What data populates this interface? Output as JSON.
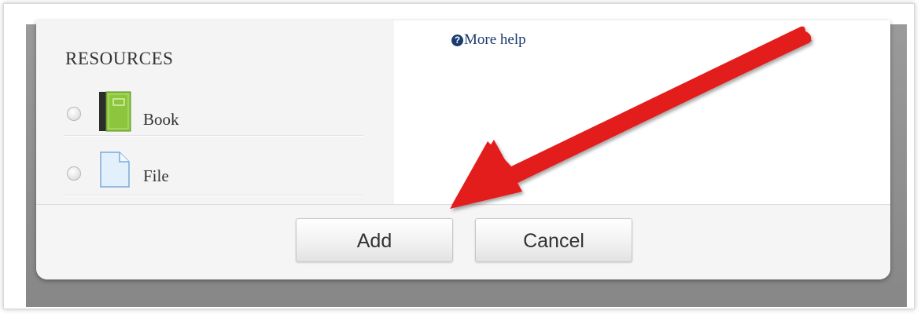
{
  "dialog": {
    "section_title": "RESOURCES",
    "options": [
      {
        "label": "Book",
        "icon": "book-icon",
        "selected": false
      },
      {
        "label": "File",
        "icon": "file-icon",
        "selected": false
      }
    ],
    "help_link": "More help",
    "help_icon": "?",
    "buttons": {
      "add": "Add",
      "cancel": "Cancel"
    }
  },
  "annotation": {
    "type": "arrow",
    "color": "#e31b1b",
    "points_to": "Add"
  }
}
